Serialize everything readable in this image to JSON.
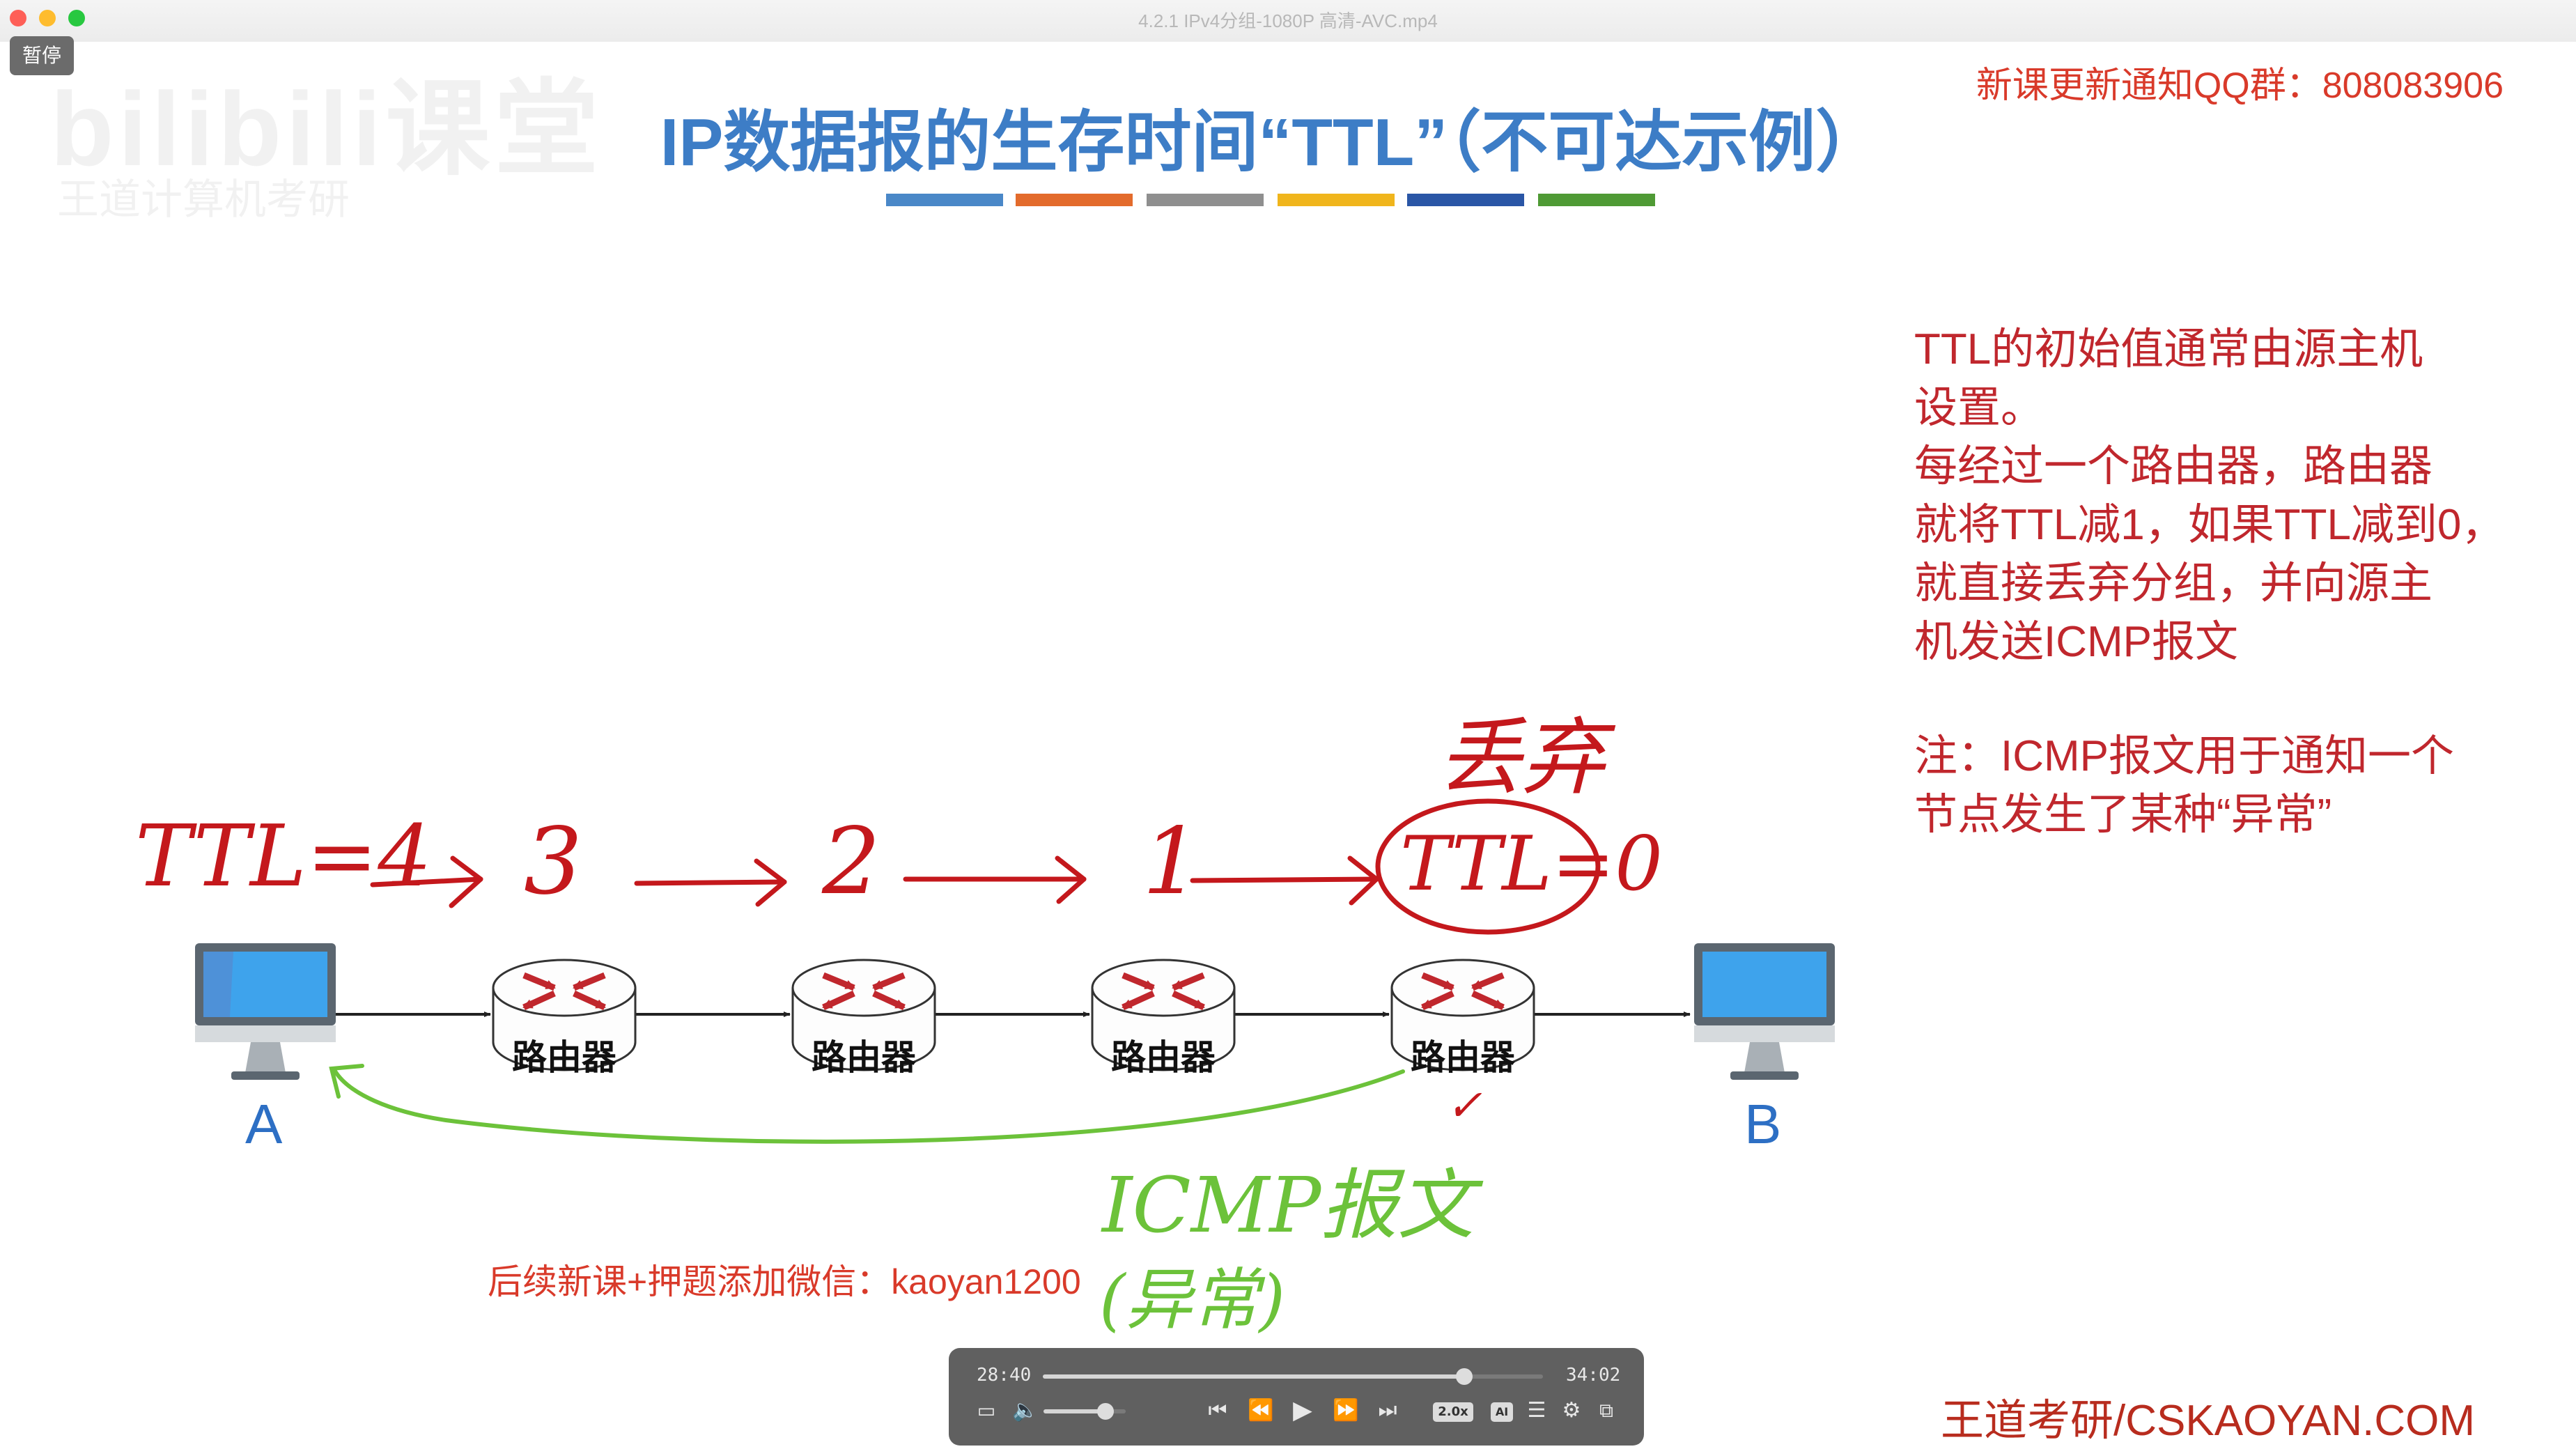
{
  "window": {
    "title": "4.2.1 IPv4分组-1080P 高清-AVC.mp4",
    "pause_badge": "暂停",
    "traffic_colors": [
      "#fe5f57",
      "#febc2e",
      "#28c840"
    ]
  },
  "slide": {
    "watermark_main": "bilibili课堂",
    "watermark_sub": "王道计算机考研",
    "notice": "新课更新通知QQ群：808083906",
    "title": "IP数据报的生存时间“TTL”（不可达示例）",
    "title_color": "#3d7dc6",
    "color_bars": [
      "#4a88c8",
      "#e36b2c",
      "#8f8f8f",
      "#f0b51c",
      "#2a56a6",
      "#4f9a35"
    ],
    "right_text": [
      "TTL的初始值通常由源主机",
      "设置。",
      "每经过一个路由器，路由器",
      "就将TTL减1，如果TTL减到0，",
      "就直接丢弃分组，并向源主",
      "机发送ICMP报文"
    ],
    "note_text": [
      "注：ICMP报文用于通知一个",
      "节点发生了某种“异常”"
    ],
    "diagram": {
      "router_labels": [
        "路由器",
        "路由器",
        "路由器",
        "路由器"
      ],
      "host_a": "A",
      "host_b": "B"
    },
    "handwriting": {
      "ttl_start": "TTL=4",
      "hop_3": "3",
      "hop_2": "2",
      "hop_1": "1",
      "ttl_zero": "TTL=0",
      "discard": "丢弃",
      "check": "✓",
      "icmp": "ICMP报文",
      "abnormal": "(异常)",
      "ink_red": "#c4181c",
      "ink_green": "#6cc23a"
    },
    "wechat": "后续新课+押题添加微信：kaoyan1200",
    "brand": "王道考研/CSKAOYAN.COM"
  },
  "player": {
    "current_time": "28:40",
    "total_time": "34:02",
    "progress": 0.842,
    "volume": 0.75,
    "speed_badge": "2.0x",
    "ai_badge": "AI",
    "icons": [
      "airplay-icon",
      "volume-icon",
      "skip-back-icon",
      "rewind-icon",
      "play-icon",
      "fast-forward-icon",
      "skip-forward-icon",
      "speed-badge",
      "ai-badge",
      "playlist-icon",
      "settings-icon",
      "pip-icon"
    ]
  }
}
